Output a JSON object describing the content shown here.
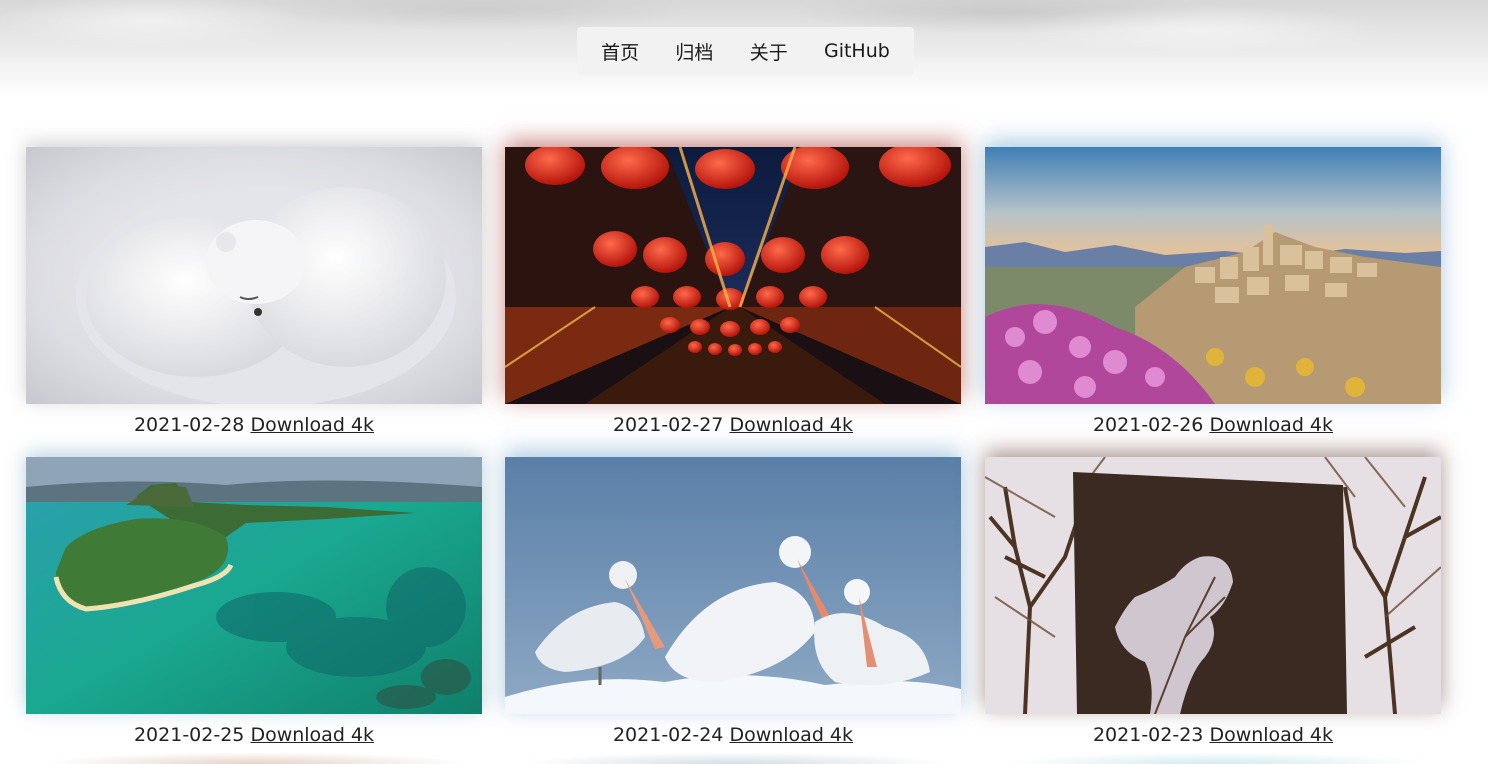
{
  "nav": {
    "items": [
      {
        "label": "首页"
      },
      {
        "label": "归档"
      },
      {
        "label": "关于"
      },
      {
        "label": "GitHub"
      }
    ]
  },
  "gallery": {
    "items": [
      {
        "date": "2021-02-28",
        "link": "Download 4k",
        "subject": "polar-bear-cubs"
      },
      {
        "date": "2021-02-27",
        "link": "Download 4k",
        "subject": "red-lanterns"
      },
      {
        "date": "2021-02-26",
        "link": "Download 4k",
        "subject": "hilltop-town"
      },
      {
        "date": "2021-02-25",
        "link": "Download 4k",
        "subject": "island-lagoon"
      },
      {
        "date": "2021-02-24",
        "link": "Download 4k",
        "subject": "pelicans"
      },
      {
        "date": "2021-02-23",
        "link": "Download 4k",
        "subject": "silhouette-sculpture"
      }
    ]
  }
}
